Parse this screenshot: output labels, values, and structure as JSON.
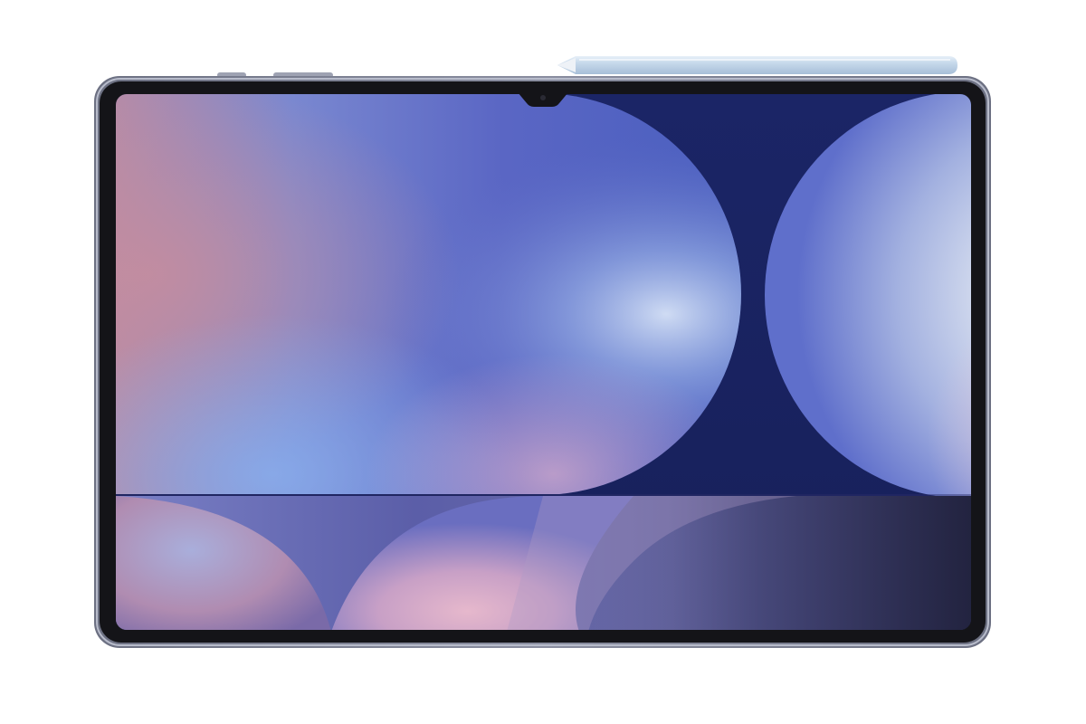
{
  "scene": {
    "subject": "tablet-with-stylus",
    "device": {
      "frame_color": "#55586a",
      "bezel_color": "#141418",
      "edge_highlight": "#b8bccb"
    },
    "stylus": {
      "color": "#c3d6ea",
      "tip_color": "#e9edf3"
    },
    "wallpaper": {
      "panels": [
        "top-left-gradient",
        "top-right-navy",
        "bottom-left-dusk",
        "bottom-right-gradient"
      ],
      "palette": [
        "#b58ba6",
        "#6f86d6",
        "#5564c2",
        "#141f57",
        "#d7e1f2",
        "#d8b4c8",
        "#2d2f5a"
      ]
    }
  }
}
